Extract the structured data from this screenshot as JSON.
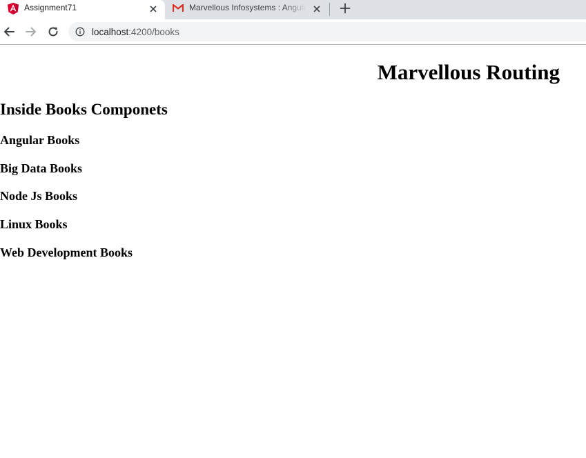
{
  "browser": {
    "tabs": [
      {
        "title": "Assignment71",
        "favicon": "angular-logo-icon",
        "active": true
      },
      {
        "title": "Marvellous Infosystems : Angular",
        "favicon": "gmail-logo-icon",
        "active": false
      }
    ],
    "address_bar": {
      "host": "localhost",
      "path": ":4200/books"
    },
    "icons": {
      "back": "arrow-left-icon",
      "forward": "arrow-right-icon",
      "reload": "reload-icon",
      "site_info": "info-icon",
      "close_tab": "close-icon",
      "new_tab": "plus-icon"
    },
    "colors": {
      "angular_red": "#dd0031",
      "gmail_red": "#d93025",
      "tabstrip": "#dee1e6",
      "omnibox": "#f1f3f4"
    }
  },
  "page": {
    "heading": "Marvellous Routing",
    "section_heading": "Inside Books Componets",
    "books": [
      "Angular Books",
      "Big Data Books",
      "Node Js Books",
      "Linux Books",
      "Web Development Books"
    ]
  }
}
